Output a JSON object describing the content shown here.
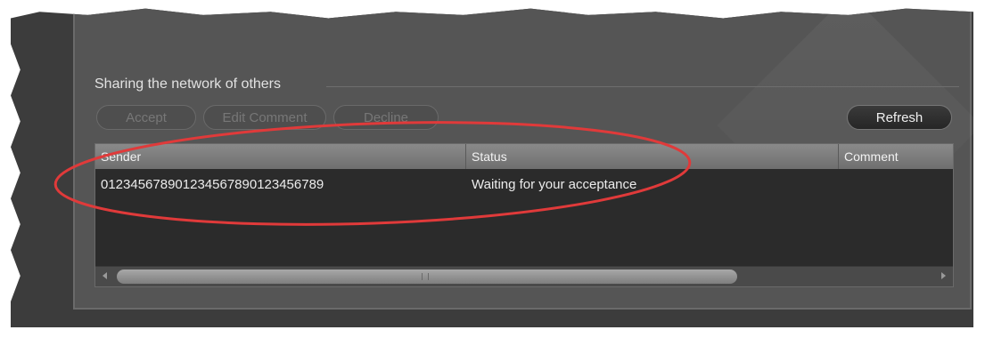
{
  "section": {
    "title": "Sharing the network of others"
  },
  "toolbar": {
    "accept_label": "Accept",
    "edit_comment_label": "Edit Comment",
    "decline_label": "Decline",
    "refresh_label": "Refresh"
  },
  "table": {
    "columns": [
      "Sender",
      "Status",
      "Comment"
    ],
    "rows": [
      {
        "sender": "012345678901234567890123456789",
        "status": "Waiting for your acceptance",
        "comment": ""
      }
    ]
  },
  "scrollbar": {
    "left_icon": "scroll-left-arrow-icon",
    "right_icon": "scroll-right-arrow-icon"
  },
  "colors": {
    "panel": "#555555",
    "grid": "#2b2b2b",
    "annotation_ring": "#e03a3a"
  }
}
